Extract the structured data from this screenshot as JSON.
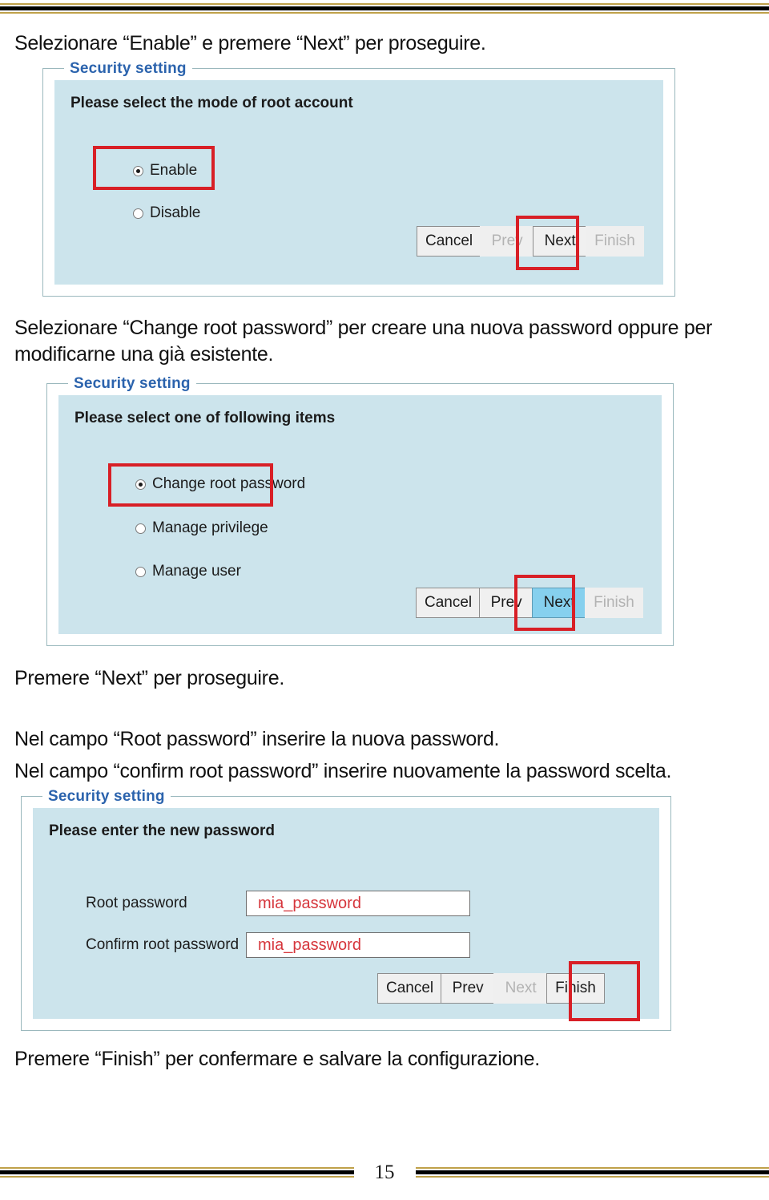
{
  "document": {
    "page_number": "15",
    "accent_rule_gold": "#bfa14a",
    "accent_rule_black": "#000000"
  },
  "paragraphs": {
    "p1": "Selezionare “Enable” e premere “Next” per proseguire.",
    "p2": "Selezionare “Change root password” per creare una nuova password oppure per modificarne una già esistente.",
    "p3": "Premere “Next” per proseguire.",
    "p4": "Nel campo “Root password” inserire la nuova password.",
    "p5": "Nel campo “confirm root password” inserire nuovamente la password scelta.",
    "p6": "Premere “Finish” per confermare e salvare la configurazione."
  },
  "figure1": {
    "legend": "Security setting",
    "prompt": "Please select the mode of root account",
    "options": [
      {
        "label": "Enable",
        "checked": true,
        "highlighted": true
      },
      {
        "label": "Disable",
        "checked": false,
        "highlighted": false
      }
    ],
    "buttons": [
      {
        "label": "Cancel",
        "state": "enabled"
      },
      {
        "label": "Prev",
        "state": "disabled"
      },
      {
        "label": "Next",
        "state": "enabled"
      },
      {
        "label": "Finish",
        "state": "disabled"
      }
    ],
    "highlighted_button": "Next"
  },
  "figure2": {
    "legend": "Security setting",
    "prompt": "Please select one of following items",
    "options": [
      {
        "label": "Change root password",
        "checked": true,
        "highlighted": true
      },
      {
        "label": "Manage privilege",
        "checked": false,
        "highlighted": false
      },
      {
        "label": "Manage user",
        "checked": false,
        "highlighted": false
      }
    ],
    "buttons": [
      {
        "label": "Cancel",
        "state": "enabled"
      },
      {
        "label": "Prev",
        "state": "enabled"
      },
      {
        "label": "Next",
        "state": "hover"
      },
      {
        "label": "Finish",
        "state": "disabled"
      }
    ],
    "highlighted_button": "Next"
  },
  "figure3": {
    "legend": "Security setting",
    "prompt": "Please enter the new password",
    "fields": [
      {
        "label": "Root password",
        "value": "mia_password"
      },
      {
        "label": "Confirm root password",
        "value": "mia_password"
      }
    ],
    "buttons": [
      {
        "label": "Cancel",
        "state": "enabled"
      },
      {
        "label": "Prev",
        "state": "enabled"
      },
      {
        "label": "Next",
        "state": "disabled"
      },
      {
        "label": "Finish",
        "state": "enabled"
      }
    ],
    "highlighted_button": "Finish"
  }
}
